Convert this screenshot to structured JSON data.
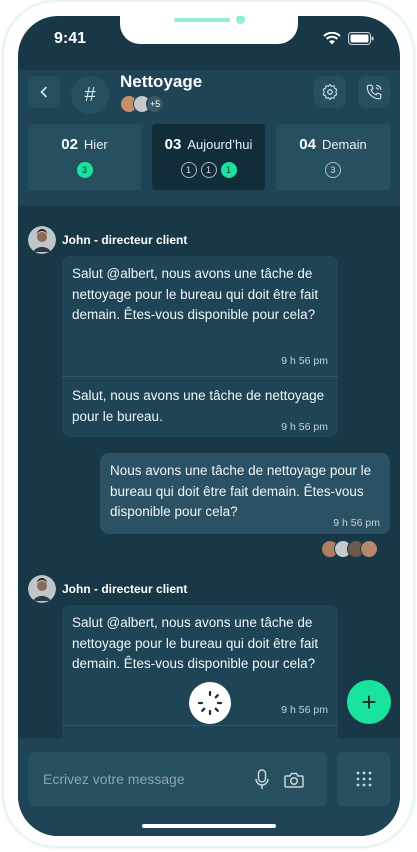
{
  "status": {
    "time": "9:41"
  },
  "channel": {
    "title": "Nettoyage",
    "members_more": "+5",
    "colors": {
      "accent": "#19e39c",
      "background": "#183847",
      "panel": "#1f4455"
    }
  },
  "day_tabs": [
    {
      "num": "02",
      "label": "Hier",
      "badges": [
        {
          "value": "3",
          "style": "green"
        }
      ]
    },
    {
      "num": "03",
      "label": "Aujourd’hui",
      "badges": [
        {
          "value": "1",
          "style": "outline"
        },
        {
          "value": "1",
          "style": "outline"
        },
        {
          "value": "1",
          "style": "green"
        }
      ]
    },
    {
      "num": "04",
      "label": "Demain",
      "badges": [
        {
          "value": "3",
          "style": "outline"
        }
      ]
    }
  ],
  "messages": [
    {
      "sender": "John - directeur client",
      "parts": [
        {
          "text": "Salut @albert, nous avons une tâche de nettoyage pour le bureau qui doit être fait demain. Êtes-vous disponible pour cela?",
          "time": "9 h 56 pm"
        },
        {
          "text": "Salut, nous avons une tâche de nettoyage pour le bureau.",
          "time": "9 h 56 pm"
        }
      ]
    },
    {
      "outgoing": true,
      "text": "Nous avons une tâche de nettoyage pour le bureau qui doit être fait demain. Êtes-vous disponible pour cela?",
      "time": "9 h 56 pm"
    },
    {
      "sender": "John - directeur client",
      "parts": [
        {
          "text": "Salut @albert, nous avons une tâche de nettoyage pour le bureau qui doit être fait demain. Êtes-vous disponible pour cela?",
          "time": "9 h 56 pm"
        }
      ]
    }
  ],
  "composer": {
    "placeholder": "Ecrivez votre message"
  }
}
